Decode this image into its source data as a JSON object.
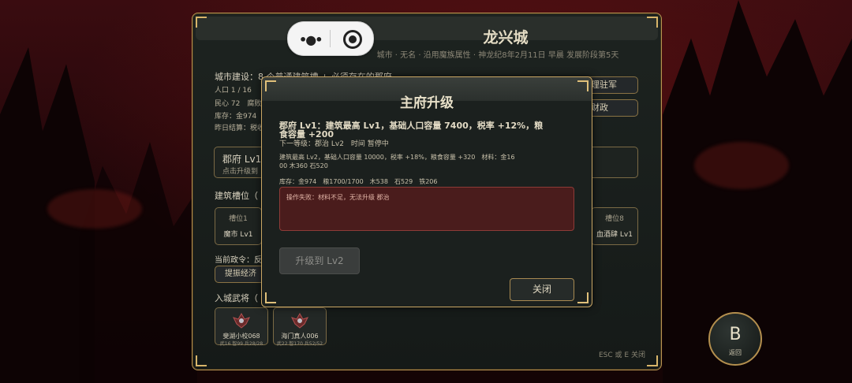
{
  "header": {
    "title": "龙兴城",
    "subtitle": "城市 · 无名 · 沿用魔族属性 · 神龙纪8年2月11日 早晨 发展阶段第5天"
  },
  "city": {
    "build_line": "城市建设：8 个普通建筑槽 + 必须存在的郡府",
    "pop": "人口 1 / 16",
    "morale": "民心 72",
    "morale_suffix": "腐败",
    "stock_short": "库存：金974",
    "yesterday": "昨日结算：税收",
    "garrison_btn": "管理驻军",
    "finance_btn": "财政",
    "hall_name": "郡府 Lv1",
    "hall_hint": "点击升级到",
    "slots_title": "建筑槽位（",
    "slot1_label": "槽位1",
    "slot1_value": "魔市 Lv1",
    "slot8_label": "槽位8",
    "slot8_value": "血酒肆 Lv1",
    "decree_label": "当前政令：反",
    "decree_btn": "提振经济",
    "generals_title": "入城武将（",
    "esc_hint": "ESC 或 E 关闭"
  },
  "generals": [
    {
      "name": "斐湖小校068",
      "stats": "武16 智99 兵28/28"
    },
    {
      "name": "海门真人006",
      "stats": "武22 智170 兵52/52"
    }
  ],
  "modal": {
    "title": "主府升级",
    "line1": "郡府 Lv1：建筑最高 Lv1，基础人口容量 7400，税率 +12%，粮",
    "line1b": "食容量 +200",
    "next": "下一等级：郡治 Lv2　时间 暂停中",
    "detail1": "建筑最高 Lv2，基础人口容量 10000，税率 +18%，粮食容量 +320　材料：金16",
    "detail2": "00 木360 石520",
    "stock": "库存：金974　粮1700/1700　木538　石529　铁206",
    "error": "操作失败：材料不足，无法升级 郡治",
    "upgrade_btn": "升级到 Lv2",
    "close_btn": "关闭"
  },
  "b_button": {
    "letter": "B",
    "label": "返回"
  },
  "colors": {
    "accent": "#caa765",
    "error_bg": "#4a1c1c",
    "error_text": "#e3b6a8"
  }
}
